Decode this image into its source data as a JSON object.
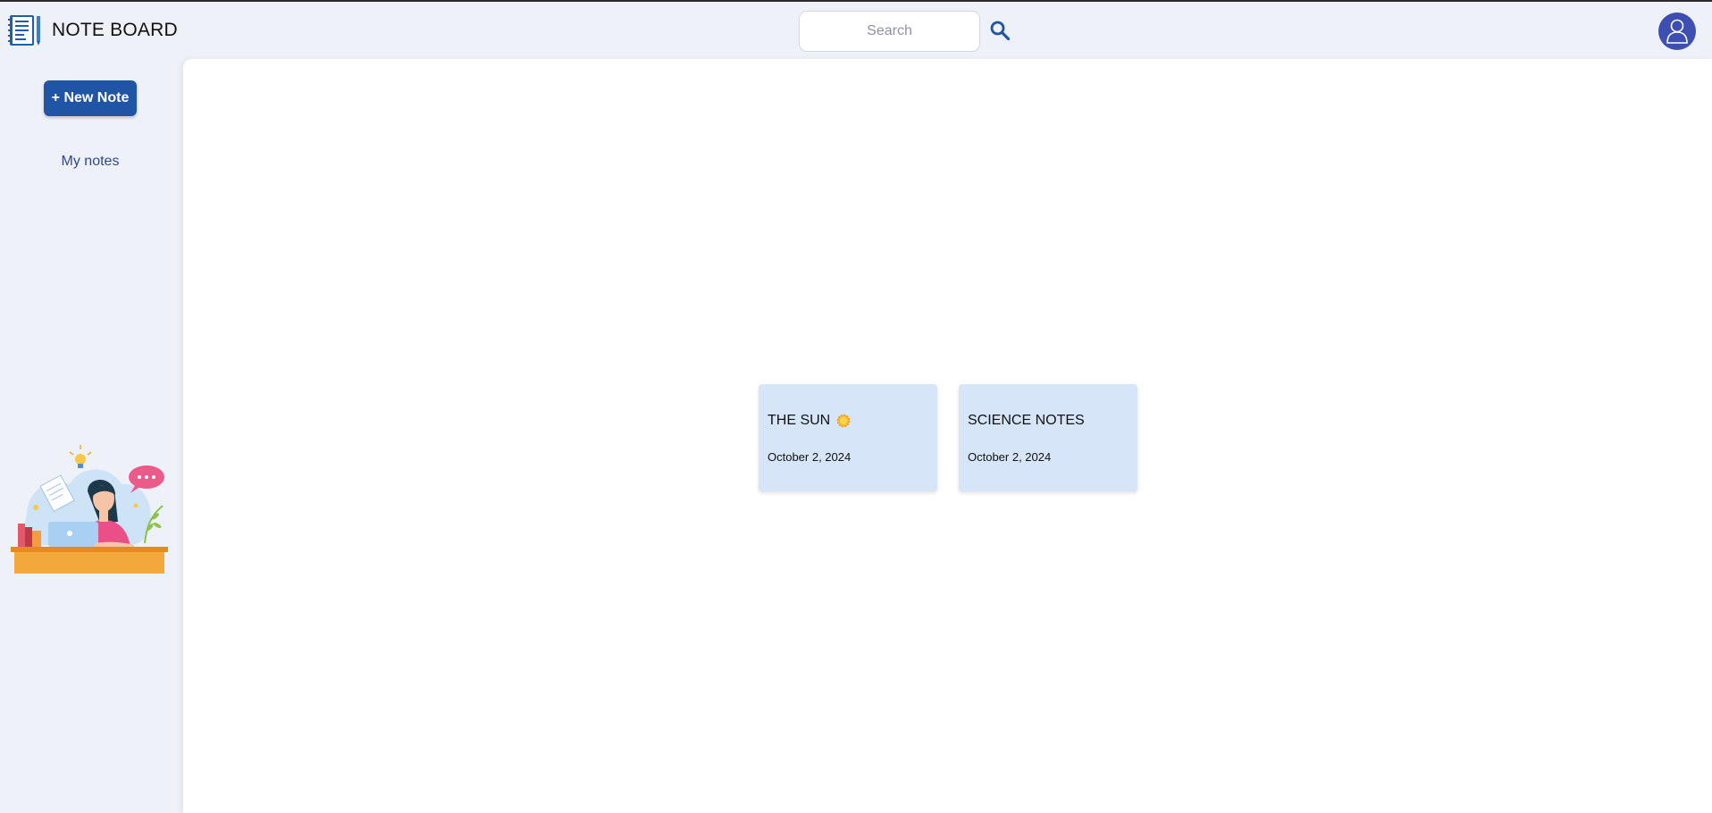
{
  "header": {
    "app_title": "NOTE BOARD",
    "app_icon": "notebook-icon",
    "search_placeholder": "Search",
    "search_value": "",
    "search_icon": "search-icon",
    "avatar_icon": "user-avatar-icon"
  },
  "sidebar": {
    "new_note_label": "+ New Note",
    "my_notes_label": "My notes",
    "illustration": "woman-at-laptop-illustration"
  },
  "notes": [
    {
      "title": "THE SUN",
      "icon": "sun-icon",
      "date": "October 2, 2024"
    },
    {
      "title": "SCIENCE NOTES",
      "date": "October 2, 2024"
    }
  ],
  "colors": {
    "brand_blue": "#2055a5",
    "card_bg": "#d6e6f8",
    "page_bg": "#eff1f8",
    "avatar_bg": "#3d4fb0"
  }
}
